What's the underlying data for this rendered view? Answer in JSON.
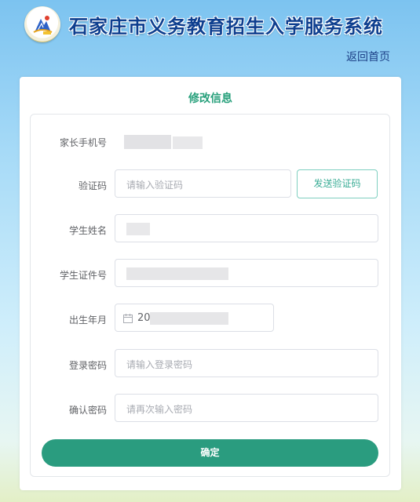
{
  "header": {
    "title": "石家庄市义务教育招生入学服务系统",
    "home_link": "返回首页",
    "logo_icon": "school-emblem-icon"
  },
  "form": {
    "title": "修改信息",
    "fields": {
      "parent_phone": {
        "label": "家长手机号",
        "value": ""
      },
      "verification_code": {
        "label": "验证码",
        "placeholder": "请输入验证码",
        "send_button": "发送验证码"
      },
      "student_name": {
        "label": "学生姓名",
        "value": ""
      },
      "student_id": {
        "label": "学生证件号",
        "value": ""
      },
      "birth_date": {
        "label": "出生年月",
        "value": "20"
      },
      "login_password": {
        "label": "登录密码",
        "placeholder": "请输入登录密码"
      },
      "confirm_password": {
        "label": "确认密码",
        "placeholder": "请再次输入密码"
      }
    },
    "submit": "确定"
  },
  "colors": {
    "accent": "#2a9c7f",
    "title_blue": "#0e3f8f",
    "section_title": "#27a07b"
  }
}
